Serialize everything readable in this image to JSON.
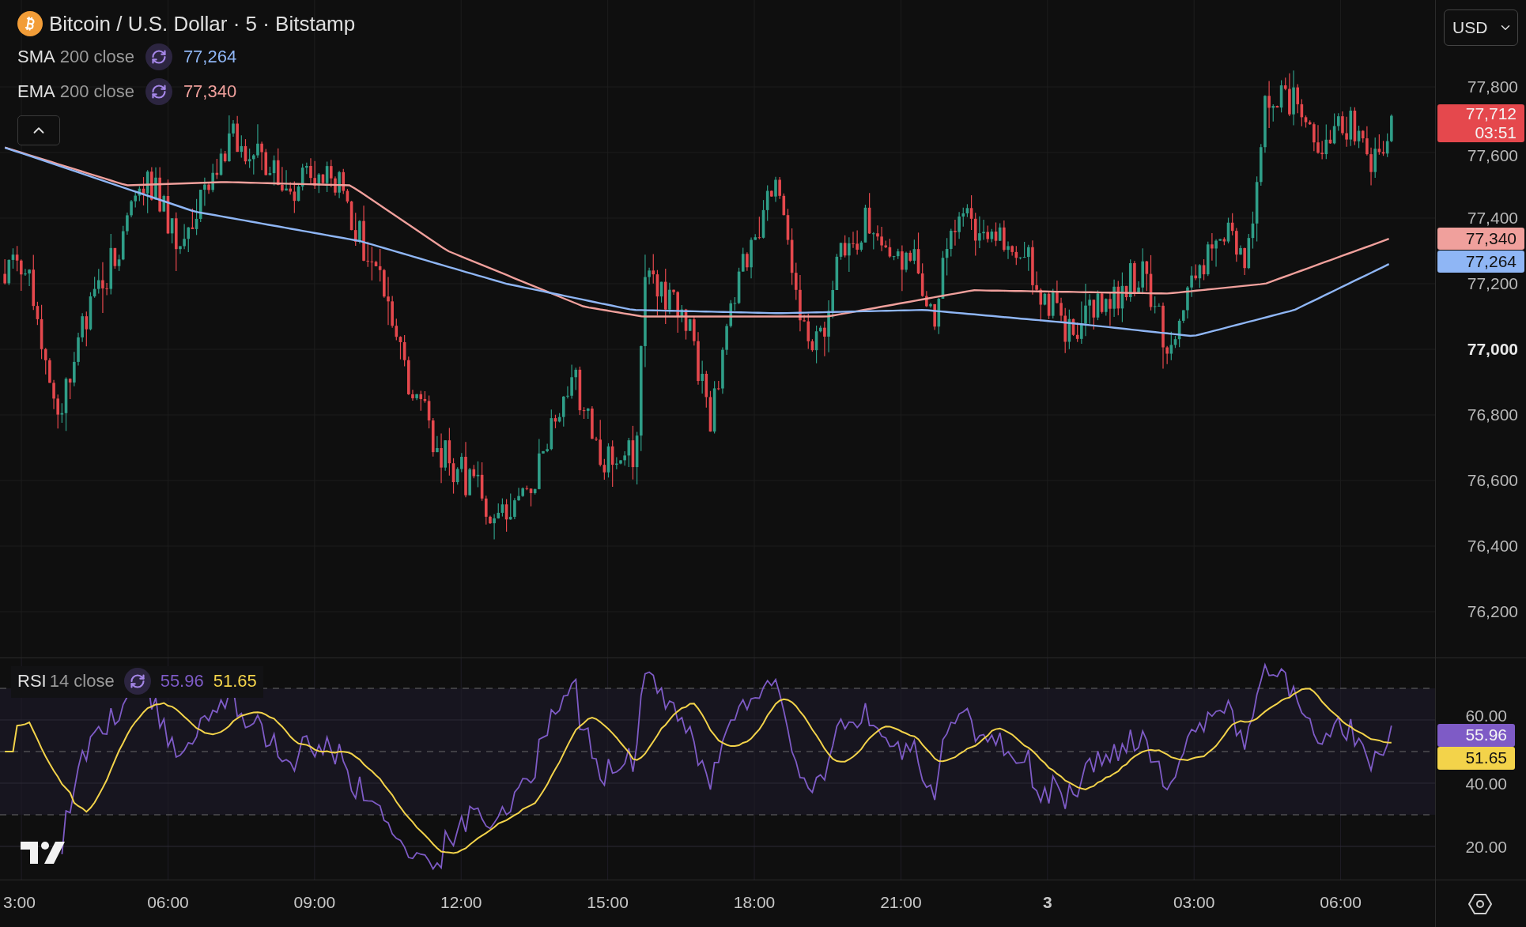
{
  "header": {
    "symbol": "Bitcoin / U.S. Dollar · 5 · Bitstamp"
  },
  "indicators": [
    {
      "name": "SMA",
      "params": "200 close",
      "value": "77,264",
      "color": "#8fb6f5"
    },
    {
      "name": "EMA",
      "params": "200 close",
      "value": "77,340",
      "color": "#f0a09c"
    }
  ],
  "currency_select": {
    "value": "USD"
  },
  "price_axis": {
    "ticks": [
      {
        "label": "77,800",
        "bold": false
      },
      {
        "label": "77,600",
        "bold": false
      },
      {
        "label": "77,400",
        "bold": false
      },
      {
        "label": "77,200",
        "bold": false
      },
      {
        "label": "77,000",
        "bold": true
      },
      {
        "label": "76,800",
        "bold": false
      },
      {
        "label": "76,600",
        "bold": false
      },
      {
        "label": "76,400",
        "bold": false
      },
      {
        "label": "76,200",
        "bold": false
      }
    ],
    "badges": [
      {
        "text": "77,712",
        "sub": "03:51",
        "color": "#e5484d"
      },
      {
        "text": "77,340",
        "color": "#f0a09c"
      },
      {
        "text": "77,264",
        "color": "#8fb6f5"
      }
    ]
  },
  "rsi": {
    "name": "RSI",
    "params": "14 close",
    "values": [
      {
        "text": "55.96",
        "color": "#7e5bc6"
      },
      {
        "text": "51.65",
        "color": "#f3d34a"
      }
    ],
    "ticks": [
      "60.00",
      "40.00",
      "20.00"
    ],
    "badges": [
      {
        "text": "55.96",
        "color": "#7e5bc6"
      },
      {
        "text": "51.65",
        "color": "#f3d34a"
      }
    ]
  },
  "time_axis": {
    "ticks": [
      {
        "label": "3:00",
        "bold": false
      },
      {
        "label": "06:00",
        "bold": false
      },
      {
        "label": "09:00",
        "bold": false
      },
      {
        "label": "12:00",
        "bold": false
      },
      {
        "label": "15:00",
        "bold": false
      },
      {
        "label": "18:00",
        "bold": false
      },
      {
        "label": "21:00",
        "bold": false
      },
      {
        "label": "3",
        "bold": true
      },
      {
        "label": "03:00",
        "bold": false
      },
      {
        "label": "06:00",
        "bold": false
      }
    ]
  }
}
